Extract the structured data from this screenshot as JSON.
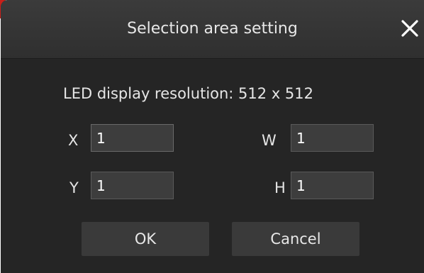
{
  "dialog": {
    "title": "Selection area setting",
    "resolution_text": "LED display resolution: 512 x 512"
  },
  "fields": {
    "x": {
      "label": "X",
      "value": "1"
    },
    "y": {
      "label": "Y",
      "value": "1"
    },
    "w": {
      "label": "W",
      "value": "1"
    },
    "h": {
      "label": "H",
      "value": "1"
    }
  },
  "buttons": {
    "ok": "OK",
    "cancel": "Cancel"
  },
  "icons": {
    "close": "close-icon"
  },
  "colors": {
    "background": "#252525",
    "titlebar": "#353535",
    "input_bg": "#3d3d3d",
    "button_bg": "#3a3a3a",
    "text": "#e6e6e6"
  }
}
